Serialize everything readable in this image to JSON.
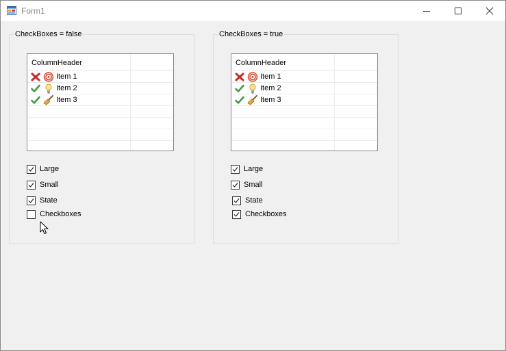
{
  "window": {
    "title": "Form1",
    "icon": "form-app-icon",
    "controls": [
      "minimize-icon",
      "maximize-icon",
      "close-icon"
    ]
  },
  "groups": [
    {
      "label": "CheckBoxes = false",
      "listview": {
        "column_header": "ColumnHeader",
        "items": [
          {
            "label": "Item 1",
            "state_icon": "red-x-icon",
            "icon": "target-icon"
          },
          {
            "label": "Item 2",
            "state_icon": "green-check-icon",
            "icon": "lightbulb-icon"
          },
          {
            "label": "Item 3",
            "state_icon": "green-check-icon",
            "icon": "broom-icon"
          }
        ]
      },
      "checkboxes": [
        {
          "label": "Large",
          "checked": true
        },
        {
          "label": "Small",
          "checked": true
        },
        {
          "label": "State",
          "checked": true
        },
        {
          "label": "Checkboxes",
          "checked": false
        }
      ]
    },
    {
      "label": "CheckBoxes = true",
      "listview": {
        "column_header": "ColumnHeader",
        "items": [
          {
            "label": "Item 1",
            "state_icon": "red-x-icon",
            "icon": "target-icon"
          },
          {
            "label": "Item 2",
            "state_icon": "green-check-icon",
            "icon": "lightbulb-icon"
          },
          {
            "label": "Item 3",
            "state_icon": "green-check-icon",
            "icon": "broom-icon"
          }
        ]
      },
      "checkboxes": [
        {
          "label": "Large",
          "checked": true
        },
        {
          "label": "Small",
          "checked": true
        },
        {
          "label": "State",
          "checked": true
        },
        {
          "label": "Checkboxes",
          "checked": true
        }
      ]
    }
  ],
  "colors": {
    "background": "#f0f0f0",
    "titlebar": "#ffffff",
    "title_text": "#8c8c8c",
    "check_green": "#3f9b3f",
    "x_red": "#c8282d"
  }
}
